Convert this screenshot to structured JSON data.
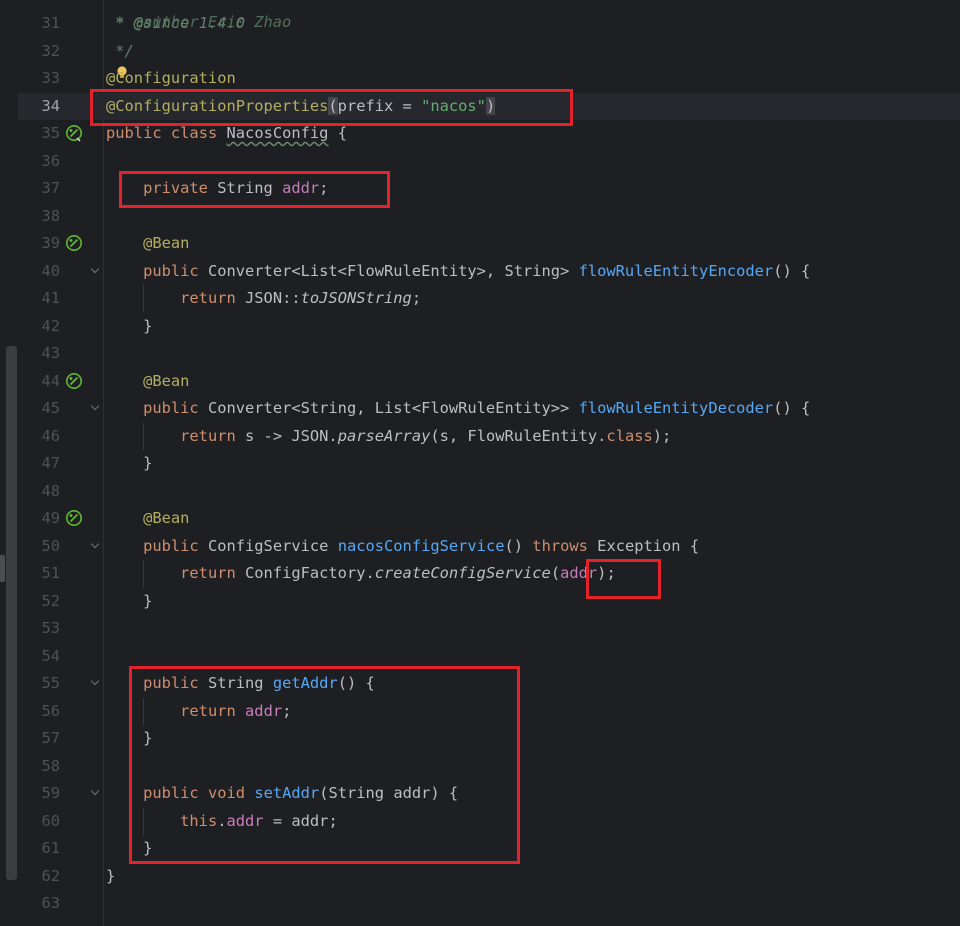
{
  "editor": {
    "current_line": "34",
    "lines": [
      {
        "num": "31",
        "code": " * @since 1.4.0"
      },
      {
        "num": "32",
        "code": " */"
      },
      {
        "num": "33",
        "code": "@Configuration"
      },
      {
        "num": "34",
        "code": "@ConfigurationProperties(prefix = \"nacos\")"
      },
      {
        "num": "35",
        "code": "public class NacosConfig {"
      },
      {
        "num": "36",
        "code": ""
      },
      {
        "num": "37",
        "code": "    private String addr;"
      },
      {
        "num": "38",
        "code": ""
      },
      {
        "num": "39",
        "code": "    @Bean"
      },
      {
        "num": "40",
        "code": "    public Converter<List<FlowRuleEntity>, String> flowRuleEntityEncoder() {"
      },
      {
        "num": "41",
        "code": "        return JSON::toJSONString;"
      },
      {
        "num": "42",
        "code": "    }"
      },
      {
        "num": "43",
        "code": ""
      },
      {
        "num": "44",
        "code": "    @Bean"
      },
      {
        "num": "45",
        "code": "    public Converter<String, List<FlowRuleEntity>> flowRuleEntityDecoder() {"
      },
      {
        "num": "46",
        "code": "        return s -> JSON.parseArray(s, FlowRuleEntity.class);"
      },
      {
        "num": "47",
        "code": "    }"
      },
      {
        "num": "48",
        "code": ""
      },
      {
        "num": "49",
        "code": "    @Bean"
      },
      {
        "num": "50",
        "code": "    public ConfigService nacosConfigService() throws Exception {"
      },
      {
        "num": "51",
        "code": "        return ConfigFactory.createConfigService(addr);"
      },
      {
        "num": "52",
        "code": "    }"
      },
      {
        "num": "53",
        "code": ""
      },
      {
        "num": "54",
        "code": ""
      },
      {
        "num": "55",
        "code": "    public String getAddr() {"
      },
      {
        "num": "56",
        "code": "        return addr;"
      },
      {
        "num": "57",
        "code": "    }"
      },
      {
        "num": "58",
        "code": ""
      },
      {
        "num": "59",
        "code": "    public void setAddr(String addr) {"
      },
      {
        "num": "60",
        "code": "        this.addr = addr;"
      },
      {
        "num": "61",
        "code": "    }"
      },
      {
        "num": "62",
        "code": "}"
      },
      {
        "num": "63",
        "code": ""
      }
    ],
    "header_partial": " * @author Eric Zhao"
  },
  "gutter_icons": {
    "bean_icon": "spring-bean-icon",
    "bulb_icon": "intention-bulb-icon",
    "fold_icon": "fold-chevron-icon"
  },
  "colors": {
    "background": "#1e1f22",
    "keyword": "#cf8e6d",
    "annotation": "#b3ae60",
    "string": "#6aab73",
    "field": "#c77dbb",
    "method": "#56a8f5",
    "comment": "#5f826b",
    "highlight_box": "#e3222b"
  }
}
